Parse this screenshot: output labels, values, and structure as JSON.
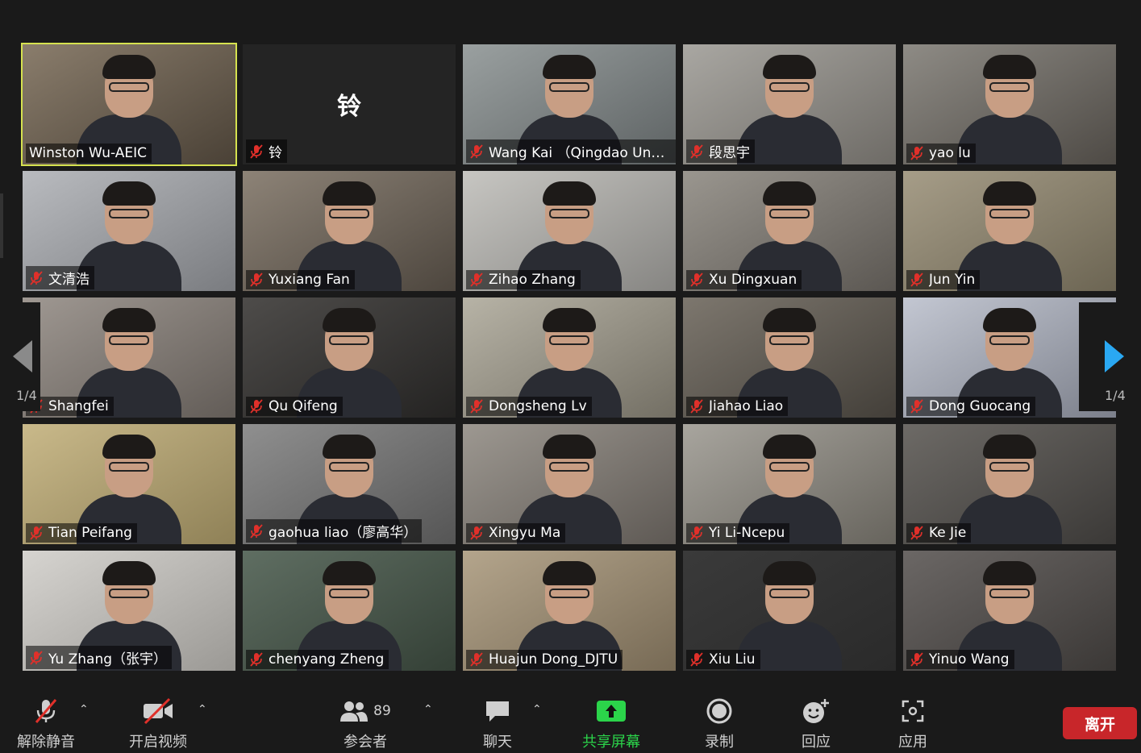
{
  "pagination": {
    "left_page": "1/4",
    "right_page": "1/4"
  },
  "participants": [
    {
      "name": "Winston Wu-AEIC",
      "muted": false,
      "video": true,
      "active": true
    },
    {
      "name": "铃",
      "muted": true,
      "video": false,
      "avatar_text": "铃"
    },
    {
      "name": "Wang Kai （Qingdao Unv...",
      "muted": true,
      "video": true
    },
    {
      "name": "段思宇",
      "muted": true,
      "video": true
    },
    {
      "name": "yao lu",
      "muted": true,
      "video": true
    },
    {
      "name": "文清浩",
      "muted": true,
      "video": true
    },
    {
      "name": "Yuxiang Fan",
      "muted": true,
      "video": true
    },
    {
      "name": "Zihao Zhang",
      "muted": true,
      "video": true
    },
    {
      "name": "Xu Dingxuan",
      "muted": true,
      "video": true
    },
    {
      "name": "Jun Yin",
      "muted": true,
      "video": true
    },
    {
      "name": "Shangfei",
      "muted": true,
      "video": true
    },
    {
      "name": "Qu Qifeng",
      "muted": true,
      "video": true
    },
    {
      "name": "Dongsheng Lv",
      "muted": true,
      "video": true
    },
    {
      "name": "Jiahao Liao",
      "muted": true,
      "video": true
    },
    {
      "name": "Dong Guocang",
      "muted": true,
      "video": true
    },
    {
      "name": "Tian Peifang",
      "muted": true,
      "video": true
    },
    {
      "name": "gaohua liao（廖高华）",
      "muted": true,
      "video": true
    },
    {
      "name": "Xingyu Ma",
      "muted": true,
      "video": true
    },
    {
      "name": "Yi Li-Ncepu",
      "muted": true,
      "video": true
    },
    {
      "name": "Ke Jie",
      "muted": true,
      "video": true
    },
    {
      "name": "Yu Zhang（张宇）",
      "muted": true,
      "video": true
    },
    {
      "name": "chenyang Zheng",
      "muted": true,
      "video": true
    },
    {
      "name": "Huajun Dong_DJTU",
      "muted": true,
      "video": true
    },
    {
      "name": "Xiu Liu",
      "muted": true,
      "video": true
    },
    {
      "name": "Yinuo Wang",
      "muted": true,
      "video": true
    }
  ],
  "toolbar": {
    "unmute_label": "解除静音",
    "start_video_label": "开启视频",
    "participants_label": "参会者",
    "participants_count": "89",
    "chat_label": "聊天",
    "share_label": "共享屏幕",
    "record_label": "录制",
    "reactions_label": "回应",
    "apps_label": "应用",
    "leave_label": "离开"
  },
  "colors": {
    "active_speaker_border": "#d6e24f",
    "muted_icon": "#e0302a",
    "share_green": "#2bd44a",
    "leave_red": "#c8262a",
    "pager_arrow": "#2aa8f2"
  }
}
